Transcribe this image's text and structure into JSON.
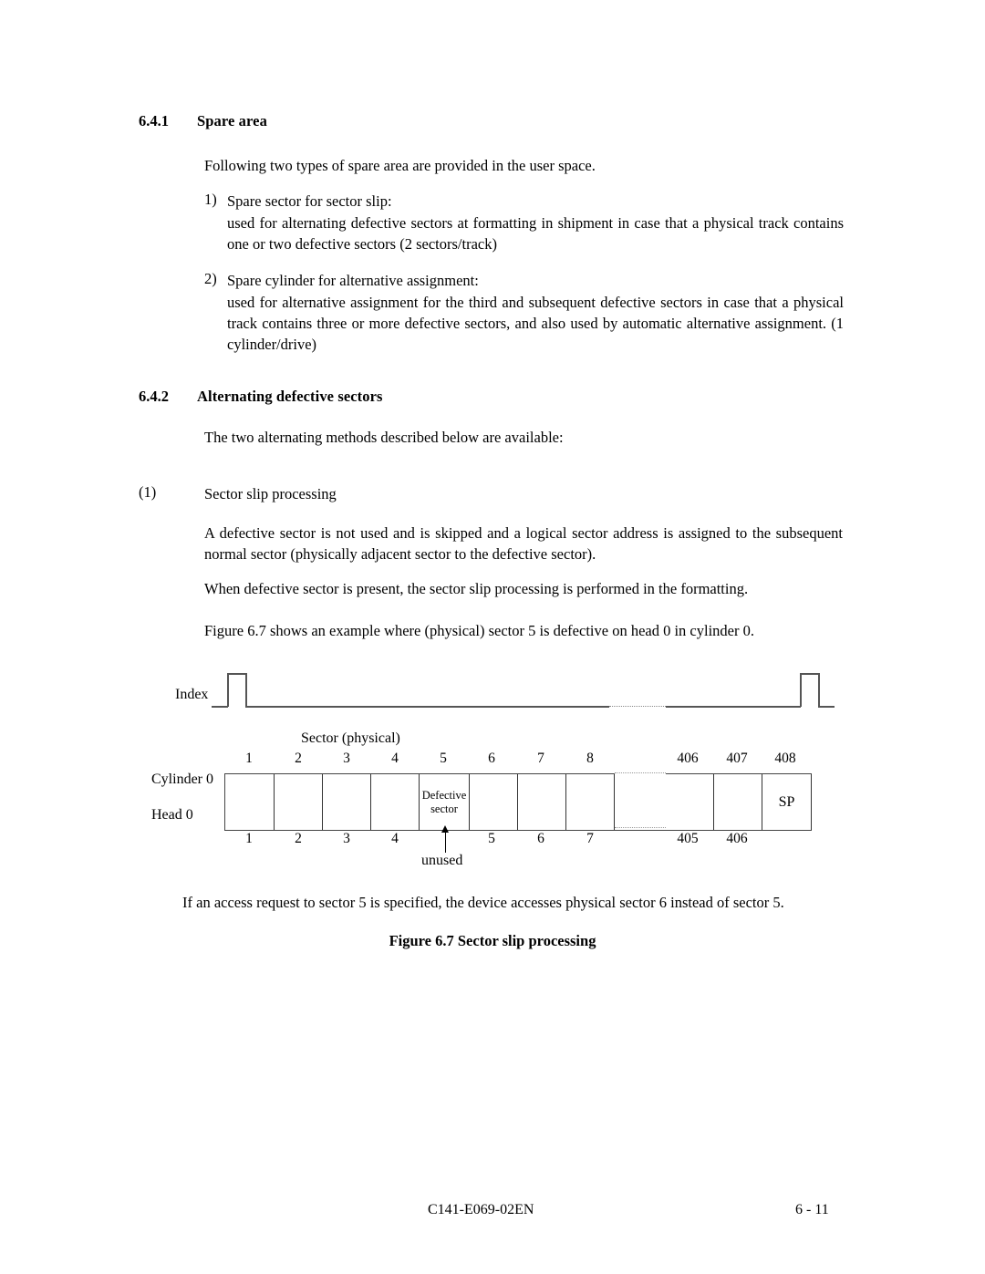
{
  "sections": [
    {
      "number": "6.4.1",
      "title": "Spare area",
      "intro": "Following two types of spare area are provided in the user space.",
      "items": [
        {
          "marker": "1)",
          "heading": "Spare sector for sector slip:",
          "body": "used for alternating defective sectors at formatting in shipment in case that a physical track contains one or two defective sectors (2 sectors/track)"
        },
        {
          "marker": "2)",
          "heading": "Spare cylinder for alternative assignment:",
          "body": "used for alternative assignment for the third and subsequent defective sectors in case that a physical track contains three or more defective sectors, and also used by automatic alternative assignment. (1 cylinder/drive)"
        }
      ]
    },
    {
      "number": "6.4.2",
      "title": "Alternating defective sectors",
      "intro": "The two alternating methods described below are available:",
      "subsection": {
        "marker": "(1)",
        "title": "Sector slip processing",
        "paragraphs": [
          "A defective sector is not used and is skipped and a logical sector address is assigned to the subsequent normal sector (physically adjacent sector to the defective sector).",
          "When defective sector is present, the sector slip processing is performed in the formatting.",
          "Figure 6.7 shows an example where (physical) sector 5 is defective on head 0 in cylinder 0."
        ]
      }
    }
  ],
  "figure": {
    "index_label": "Index",
    "sector_axis_label": "Sector (physical)",
    "row_labels": [
      "Cylinder 0",
      "Head 0"
    ],
    "physical_numbers": [
      "1",
      "2",
      "3",
      "4",
      "5",
      "6",
      "7",
      "8",
      "",
      "406",
      "407",
      "408"
    ],
    "logical_numbers": [
      "1",
      "2",
      "3",
      "4",
      "",
      "5",
      "6",
      "7",
      "",
      "405",
      "406",
      ""
    ],
    "defective_cell_text_line1": "Defective",
    "defective_cell_text_line2": "sector",
    "spare_cell_text": "SP",
    "unused_label": "unused",
    "note": "If an access request to sector 5 is specified, the device accesses physical sector 6 instead of sector 5.",
    "caption": "Figure 6.7    Sector slip processing"
  },
  "footer": {
    "document_id": "C141-E069-02EN",
    "page_number": "6 - 11"
  }
}
